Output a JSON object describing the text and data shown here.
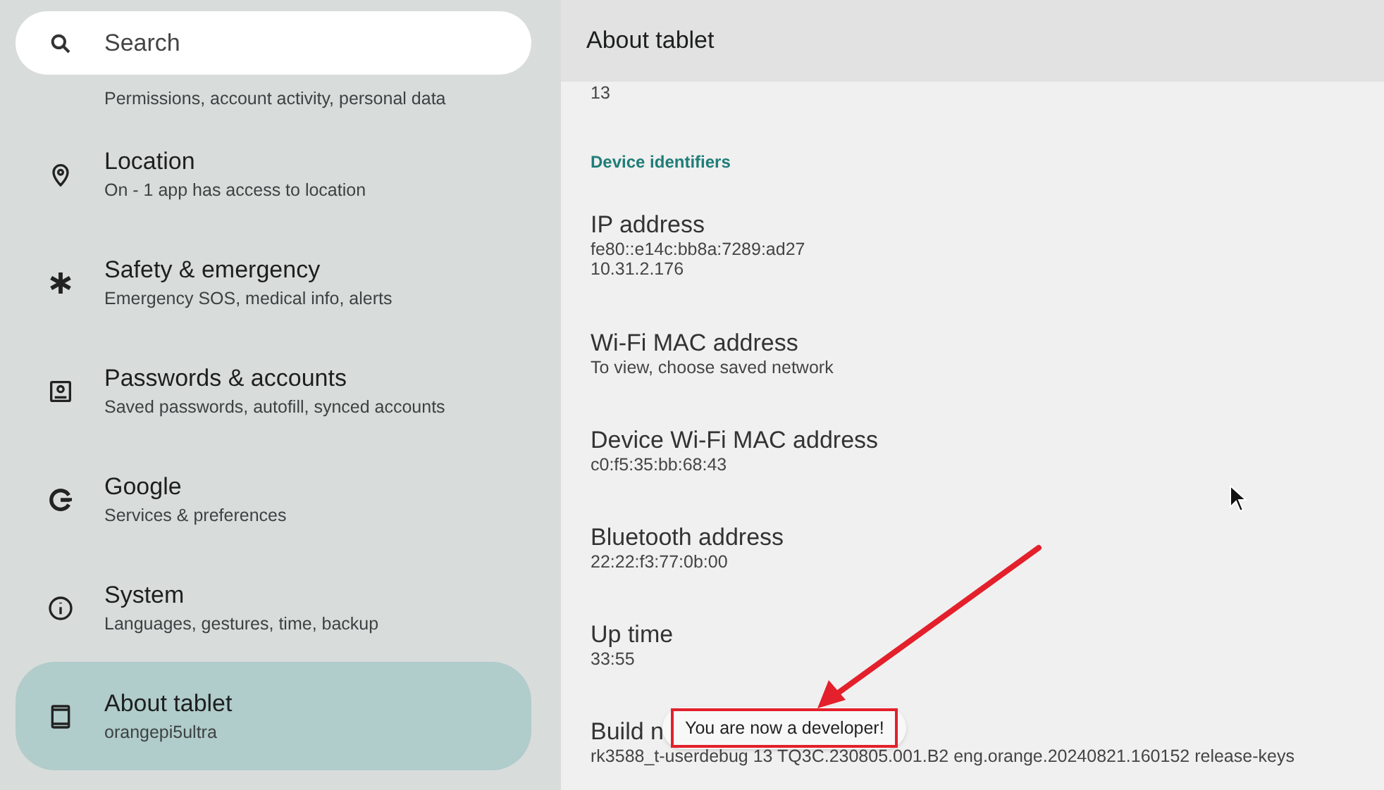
{
  "search": {
    "placeholder": "Search"
  },
  "sidebar": {
    "items": [
      {
        "summary": "Permissions, account activity, personal data",
        "selected": false
      },
      {
        "title": "Location",
        "summary": "On - 1 app has access to location",
        "selected": false
      },
      {
        "title": "Safety & emergency",
        "summary": "Emergency SOS, medical info, alerts",
        "selected": false
      },
      {
        "title": "Passwords & accounts",
        "summary": "Saved passwords, autofill, synced accounts",
        "selected": false
      },
      {
        "title": "Google",
        "summary": "Services & preferences",
        "selected": false
      },
      {
        "title": "System",
        "summary": "Languages, gestures, time, backup",
        "selected": false
      },
      {
        "title": "About tablet",
        "summary": "orangepi5ultra",
        "selected": true
      }
    ]
  },
  "detail": {
    "title": "About tablet",
    "items": [
      {
        "kind": "value",
        "summary": [
          "13"
        ]
      },
      {
        "kind": "header",
        "title": "Device identifiers"
      },
      {
        "kind": "pref",
        "title": "IP address",
        "summary": [
          "fe80::e14c:bb8a:7289:ad27",
          "10.31.2.176"
        ]
      },
      {
        "kind": "pref",
        "title": "Wi-Fi MAC address",
        "summary": [
          "To view, choose saved network"
        ]
      },
      {
        "kind": "pref",
        "title": "Device Wi-Fi MAC address",
        "summary": [
          "c0:f5:35:bb:68:43"
        ]
      },
      {
        "kind": "pref",
        "title": "Bluetooth address",
        "summary": [
          "22:22:f3:77:0b:00"
        ]
      },
      {
        "kind": "pref",
        "title": "Up time",
        "summary": [
          "33:55"
        ]
      },
      {
        "kind": "pref",
        "title": "Build n",
        "summary": [
          "rk3588_t-userdebug 13 TQ3C.230805.001.B2 eng.orange.20240821.160152 release-keys"
        ]
      }
    ]
  },
  "toast": {
    "text": "You are now a developer!",
    "highlighted": true
  }
}
